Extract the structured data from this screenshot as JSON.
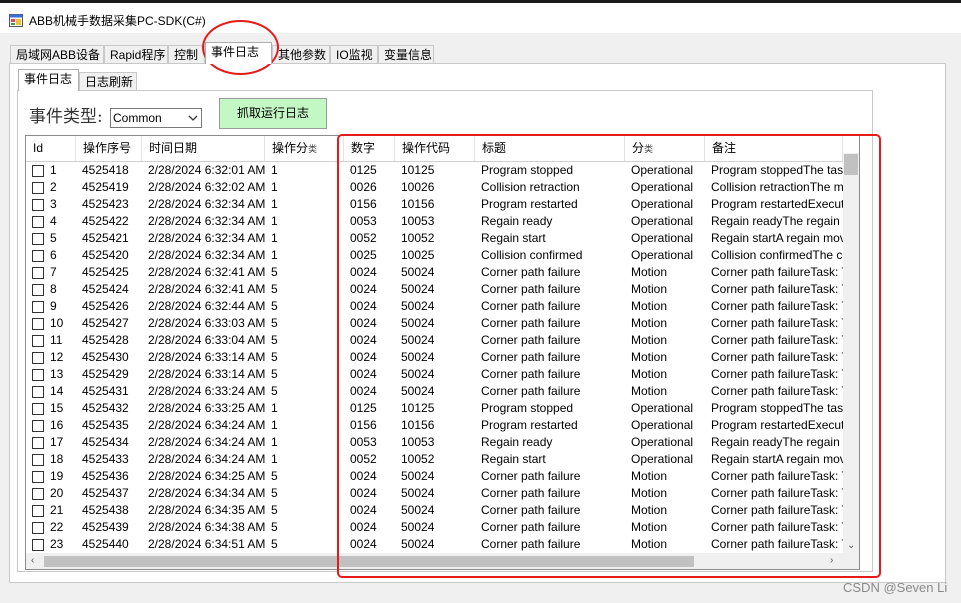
{
  "window": {
    "title": "ABB机械手数据采集PC-SDK(C#)"
  },
  "main_tabs": [
    "局域网ABB设备",
    "Rapid程序",
    "控制",
    "事件日志",
    "其他参数",
    "IO监视",
    "变量信息"
  ],
  "active_main_tab": "事件日志",
  "sub_tabs": [
    "事件日志",
    "日志刷新"
  ],
  "active_sub_tab": "事件日志",
  "event_type": {
    "label": "事件类型:",
    "selected": "Common"
  },
  "fetch_button": "抓取运行日志",
  "table": {
    "columns": [
      {
        "label": "Id"
      },
      {
        "label": "操作序号"
      },
      {
        "label": "时间日期"
      },
      {
        "label": "操作分",
        "suffix": "类"
      },
      {
        "label": "数字"
      },
      {
        "label": "操作代码"
      },
      {
        "label": "标题"
      },
      {
        "label": "分",
        "suffix": "类"
      },
      {
        "label": "备注"
      }
    ],
    "rows": [
      [
        "1",
        "4525418",
        "2/28/2024 6:32:01 AM",
        "1",
        "0125",
        "10125",
        "Program stopped",
        "Operational",
        "Program stoppedThe task T"
      ],
      [
        "2",
        "4525419",
        "2/28/2024 6:32:02 AM",
        "1",
        "0026",
        "10026",
        "Collision retraction",
        "Operational",
        "Collision retractionThe manip"
      ],
      [
        "3",
        "4525423",
        "2/28/2024 6:32:34 AM",
        "1",
        "0156",
        "10156",
        "Program restarted",
        "Operational",
        "Program restartedExecution"
      ],
      [
        "4",
        "4525422",
        "2/28/2024 6:32:34 AM",
        "1",
        "0053",
        "10053",
        "Regain ready",
        "Operational",
        "Regain readyThe regain mo"
      ],
      [
        "5",
        "4525421",
        "2/28/2024 6:32:34 AM",
        "1",
        "0052",
        "10052",
        "Regain start",
        "Operational",
        "Regain startA regain movem"
      ],
      [
        "6",
        "4525420",
        "2/28/2024 6:32:34 AM",
        "1",
        "0025",
        "10025",
        "Collision confirmed",
        "Operational",
        "Collision confirmedThe collis"
      ],
      [
        "7",
        "4525425",
        "2/28/2024 6:32:41 AM",
        "5",
        "0024",
        "50024",
        "Corner path failure",
        "Motion",
        "Corner path failureTask: T_"
      ],
      [
        "8",
        "4525424",
        "2/28/2024 6:32:41 AM",
        "5",
        "0024",
        "50024",
        "Corner path failure",
        "Motion",
        "Corner path failureTask: T_"
      ],
      [
        "9",
        "4525426",
        "2/28/2024 6:32:44 AM",
        "5",
        "0024",
        "50024",
        "Corner path failure",
        "Motion",
        "Corner path failureTask: T_"
      ],
      [
        "10",
        "4525427",
        "2/28/2024 6:33:03 AM",
        "5",
        "0024",
        "50024",
        "Corner path failure",
        "Motion",
        "Corner path failureTask: T_"
      ],
      [
        "11",
        "4525428",
        "2/28/2024 6:33:04 AM",
        "5",
        "0024",
        "50024",
        "Corner path failure",
        "Motion",
        "Corner path failureTask: T_"
      ],
      [
        "12",
        "4525430",
        "2/28/2024 6:33:14 AM",
        "5",
        "0024",
        "50024",
        "Corner path failure",
        "Motion",
        "Corner path failureTask: T_"
      ],
      [
        "13",
        "4525429",
        "2/28/2024 6:33:14 AM",
        "5",
        "0024",
        "50024",
        "Corner path failure",
        "Motion",
        "Corner path failureTask: T_"
      ],
      [
        "14",
        "4525431",
        "2/28/2024 6:33:24 AM",
        "5",
        "0024",
        "50024",
        "Corner path failure",
        "Motion",
        "Corner path failureTask: T_"
      ],
      [
        "15",
        "4525432",
        "2/28/2024 6:33:25 AM",
        "1",
        "0125",
        "10125",
        "Program stopped",
        "Operational",
        "Program stoppedThe task T"
      ],
      [
        "16",
        "4525435",
        "2/28/2024 6:34:24 AM",
        "1",
        "0156",
        "10156",
        "Program restarted",
        "Operational",
        "Program restartedExecution"
      ],
      [
        "17",
        "4525434",
        "2/28/2024 6:34:24 AM",
        "1",
        "0053",
        "10053",
        "Regain ready",
        "Operational",
        "Regain readyThe regain mo"
      ],
      [
        "18",
        "4525433",
        "2/28/2024 6:34:24 AM",
        "1",
        "0052",
        "10052",
        "Regain start",
        "Operational",
        "Regain startA regain movem"
      ],
      [
        "19",
        "4525436",
        "2/28/2024 6:34:25 AM",
        "5",
        "0024",
        "50024",
        "Corner path failure",
        "Motion",
        "Corner path failureTask: T_"
      ],
      [
        "20",
        "4525437",
        "2/28/2024 6:34:34 AM",
        "5",
        "0024",
        "50024",
        "Corner path failure",
        "Motion",
        "Corner path failureTask: T_"
      ],
      [
        "21",
        "4525438",
        "2/28/2024 6:34:35 AM",
        "5",
        "0024",
        "50024",
        "Corner path failure",
        "Motion",
        "Corner path failureTask: T_"
      ],
      [
        "22",
        "4525439",
        "2/28/2024 6:34:38 AM",
        "5",
        "0024",
        "50024",
        "Corner path failure",
        "Motion",
        "Corner path failureTask: T_"
      ],
      [
        "23",
        "4525440",
        "2/28/2024 6:34:51 AM",
        "5",
        "0024",
        "50024",
        "Corner path failure",
        "Motion",
        "Corner path failureTask: T_"
      ]
    ]
  },
  "watermark": "CSDN @Seven Li",
  "colors": {
    "annotation": "#e51b1b",
    "button_green": "#c3f7c3",
    "scrollbar_thumb": "#c1c1c1"
  },
  "icons": [
    "app-window-icon",
    "dropdown-chevron-icon",
    "scroll-up-icon",
    "scroll-down-icon",
    "scroll-left-icon",
    "scroll-right-icon"
  ]
}
